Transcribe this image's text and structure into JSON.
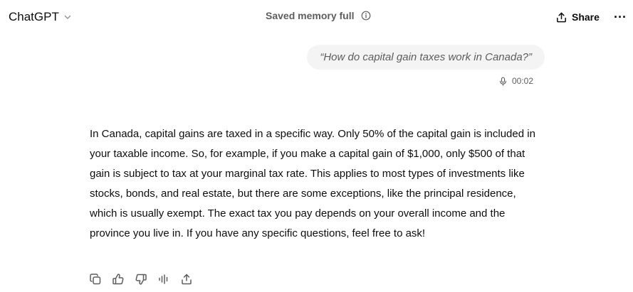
{
  "header": {
    "model_name": "ChatGPT",
    "memory_status": "Saved memory full",
    "share_label": "Share",
    "more_label": "···"
  },
  "conversation": {
    "user_message": {
      "text": "“How do capital gain taxes work in Canada?”",
      "voice_duration": "00:02"
    },
    "assistant_message": {
      "text": "In Canada, capital gains are taxed in a specific way. Only 50% of the capital gain is included in your taxable income. So, for example, if you make a capital gain of $1,000, only $500 of that gain is subject to tax at your marginal tax rate. This applies to most types of investments like stocks, bonds, and real estate, but there are some exceptions, like the principal residence, which is usually exempt. The exact tax you pay depends on your overall income and the province you live in. If you have any specific questions, feel free to ask!"
    },
    "actions": [
      "copy-icon",
      "thumbs-up-icon",
      "thumbs-down-icon",
      "read-aloud-icon",
      "share-icon"
    ]
  }
}
